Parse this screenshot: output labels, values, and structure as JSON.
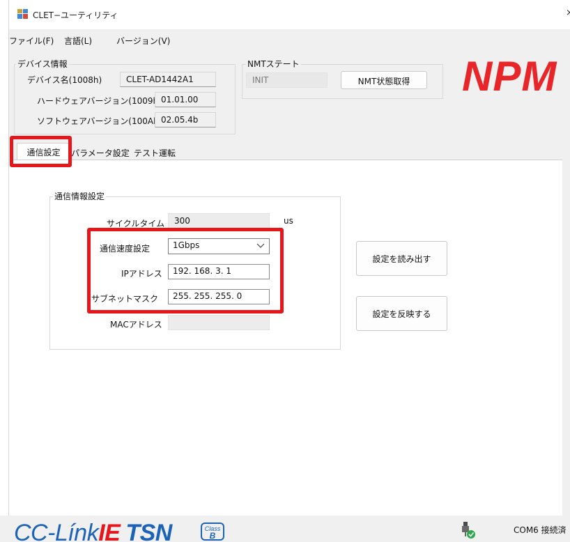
{
  "window": {
    "title": "CLET−ユーティリティ",
    "close_glyph": "×"
  },
  "menu": [
    {
      "label": "ファイル(F)"
    },
    {
      "label": "言語(L)"
    },
    {
      "label": "バージョン(V)"
    }
  ],
  "device_info": {
    "legend": "デバイス情報",
    "device_name_label": "デバイス名(1008h)",
    "device_name_value": "CLET-AD1442A1",
    "hw_version_label": "ハードウェアバージョン(1009h)",
    "hw_version_value": "01.01.00",
    "sw_version_label": "ソフトウェアバージョン(100Ah)",
    "sw_version_value": "02.05.4b"
  },
  "nmt": {
    "legend": "NMTステート",
    "state_value": "INIT",
    "get_button": "NMT状態取得"
  },
  "logo_text": "NPM",
  "tabs": [
    {
      "label": "通信設定",
      "active": true
    },
    {
      "label": "パラメータ設定",
      "active": false
    },
    {
      "label": "テスト運転",
      "active": false
    }
  ],
  "comm_settings": {
    "legend": "通信情報設定",
    "cycle_time_label": "サイクルタイム",
    "cycle_time_value": "300",
    "cycle_time_unit": "us",
    "speed_label": "通信速度設定",
    "speed_value": "1Gbps",
    "ip_label": "IPアドレス",
    "ip_value": "192. 168. 3. 1",
    "subnet_label": "サブネットマスク",
    "subnet_value": "255. 255. 255. 0",
    "mac_label": "MACアドレス",
    "mac_value": ""
  },
  "buttons": {
    "read_settings": "設定を読み出す",
    "apply_settings": "設定を反映する"
  },
  "footer": {
    "logo_cc": "CC-Línk",
    "logo_ie": "IE",
    "logo_tsn": "TSN",
    "class_label": "Class",
    "class_value": "B",
    "status": "COM6 接続済"
  },
  "colors": {
    "highlight": "#e5171b",
    "npm_red": "#e8262a",
    "cclink_blue": "#1c63b8"
  },
  "icons": [
    "app-icon",
    "close-icon",
    "chevron-down-icon",
    "usb-connected-icon"
  ]
}
